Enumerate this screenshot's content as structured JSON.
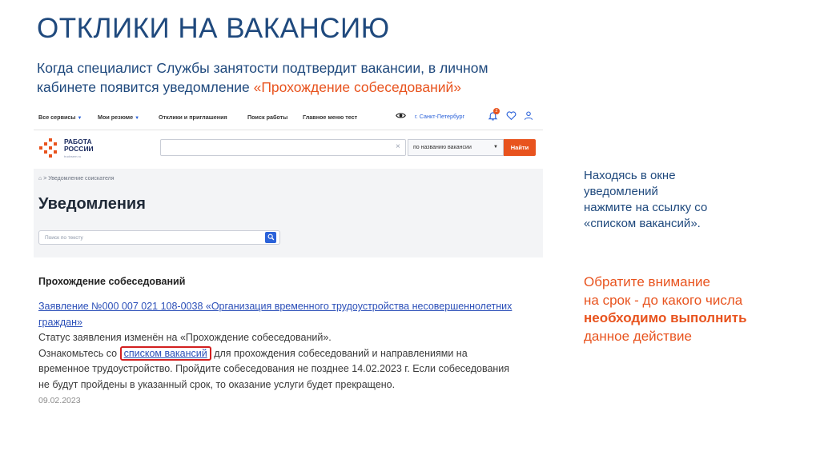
{
  "slide": {
    "title": "ОТКЛИКИ НА ВАКАНСИЮ",
    "intro_line1": "Когда специалист Службы занятости подтвердит вакансии, в личном",
    "intro_line2": "кабинете появится уведомление ",
    "intro_highlight": "«Прохождение собеседований»"
  },
  "site": {
    "nav": {
      "all_services": "Все сервисы",
      "my_resumes": "Мои резюме",
      "responses": "Отклики и приглашения",
      "job_search": "Поиск работы",
      "main_menu": "Главное меню тест",
      "city": "г. Санкт-Петербург",
      "notification_count": "2"
    },
    "logo": {
      "line1": "РАБОТА",
      "line2": "РОССИИ",
      "sub": "trudvsem.ru"
    },
    "search": {
      "value": "",
      "clear": "×",
      "type_selected": "по названию вакансии",
      "button": "Найти"
    },
    "breadcrumb": {
      "home": "⌂",
      "sep": ">",
      "current": "Уведомление соискателя"
    },
    "page_title": "Уведомления",
    "filter_placeholder": "Поиск по тексту"
  },
  "notification": {
    "title": "Прохождение собеседований",
    "link": "Заявление №000 007 021 108-0038 «Организация временного трудоустройства несовершеннолетних граждан»",
    "status_text": "Статус заявления изменён на «Прохождение собеседований».",
    "text_before_link": "Ознакомьтесь со ",
    "vacancy_link": "списком вакансий",
    "text_after_link": " для прохождения собеседований и направлениями на временное трудоустройство. Пройдите собеседования не позднее 14.02.2023 г. Если собеседования не будут пройдены в указанный срок, то оказание услуги будет прекращено.",
    "date": "09.02.2023"
  },
  "notes": {
    "note1_l1": "Находясь в окне",
    "note1_l2": "уведомлений",
    "note1_l3": "нажмите на ссылку со",
    "note1_l4": "«списком вакансий».",
    "note2_l1": "Обратите внимание",
    "note2_l2": "на срок - до какого числа",
    "note2_l3": "необходимо выполнить",
    "note2_l4": "данное действие"
  },
  "colors": {
    "title_blue": "#1f497d",
    "accent_orange": "#e8531e",
    "link_blue": "#2b4fb8",
    "highlight_red": "#d21f1f"
  }
}
